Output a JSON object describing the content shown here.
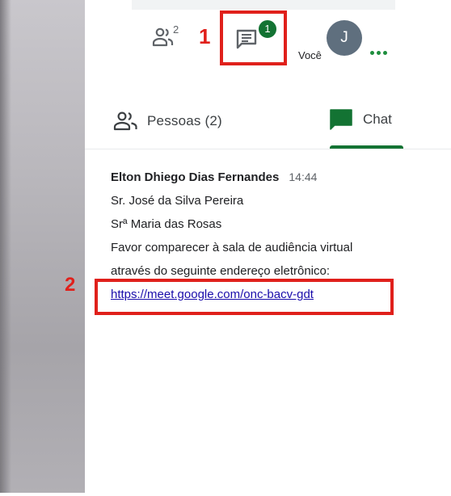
{
  "header": {
    "participants_count": "2",
    "chat_unread_badge": "1",
    "avatar_initial": "J",
    "user_label": "Você",
    "people_icon": "people-icon",
    "chat_icon": "chat-bubble-icon",
    "more_icon": "more-dots-icon"
  },
  "annotations": {
    "marker_1": "1",
    "marker_2": "2",
    "highlight_color": "#e0201b"
  },
  "tabs": {
    "people_label": "Pessoas (2)",
    "chat_label": "Chat",
    "active_tab": "Chat",
    "accent_color": "#137333"
  },
  "message": {
    "sender": "Elton Dhiego Dias Fernandes",
    "time": "14:44",
    "lines": [
      "Sr. José da Silva Pereira",
      "Srª Maria das Rosas",
      "Favor comparecer à sala de audiência virtual",
      "através do seguinte endereço eletrônico:"
    ],
    "link": "https://meet.google.com/onc-bacv-gdt"
  }
}
